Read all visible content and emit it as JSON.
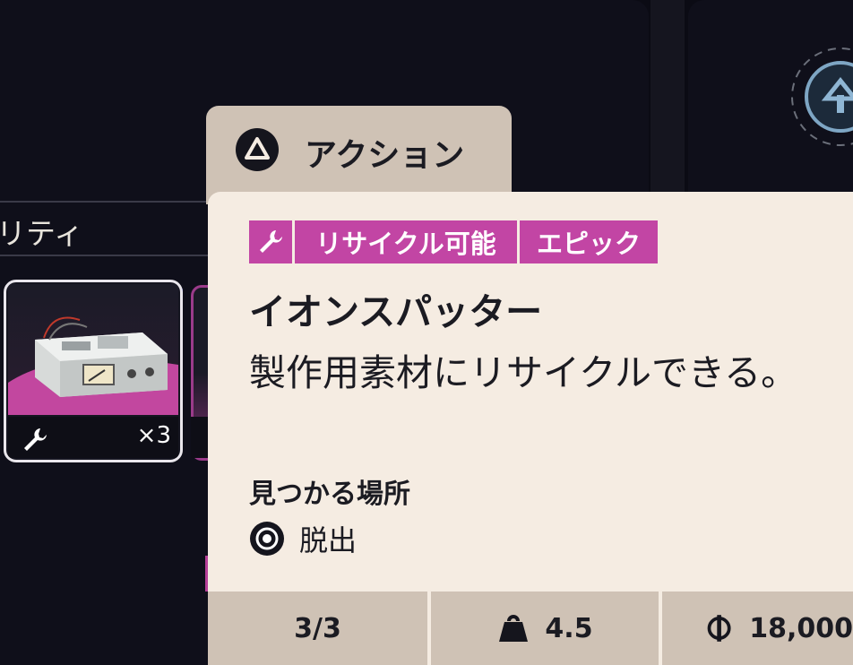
{
  "filter": {
    "label": "リティ"
  },
  "item_card": {
    "quantity": "×3",
    "icon": "wrench-icon"
  },
  "action": {
    "label": "アクション",
    "icon": "triangle-button-icon"
  },
  "tooltip": {
    "tags": {
      "icon": "wrench-icon",
      "recycle": "リサイクル可能",
      "rarity": "エピック"
    },
    "title": "イオンスパッター",
    "description": "製作用素材にリサイクルできる。",
    "found_heading": "見つかる場所",
    "found_location": "脱出",
    "found_icon": "target-icon"
  },
  "stats": {
    "stack": "3/3",
    "weight": "4.5",
    "weight_icon": "weight-icon",
    "value": "18,000",
    "value_icon": "currency-icon"
  },
  "colors": {
    "tag_bg": "#c245a4",
    "tooltip_bg": "#f5ece2",
    "tab_bg": "#cfc2b5",
    "background": "#0b0b14"
  }
}
